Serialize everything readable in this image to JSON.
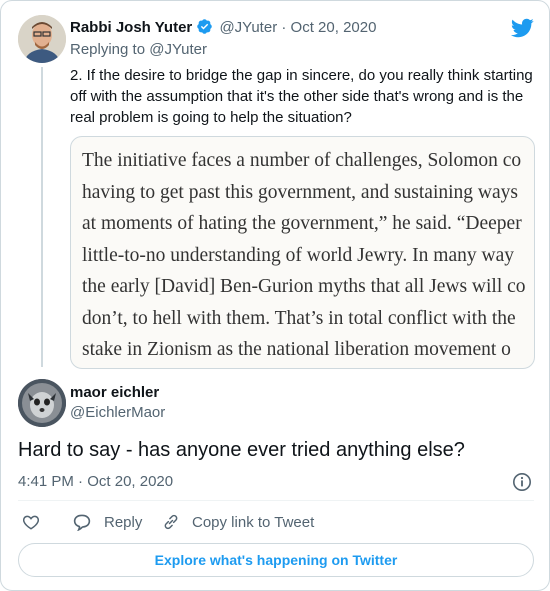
{
  "colors": {
    "accent": "#1d9bf0",
    "muted": "#536471",
    "text": "#0f1419",
    "border": "#cfd9de"
  },
  "parent_tweet": {
    "author_name": "Rabbi Josh Yuter",
    "handle": "@JYuter",
    "separator": "·",
    "date": "Oct 20, 2020",
    "replying_to_prefix": "Replying to",
    "replying_to_handle": "@JYuter",
    "text": "2. If the desire to bridge the gap in sincere, do you really think starting off with the assumption that it's the other side that's wrong and is the real problem is going to help the situation?",
    "image_lines": [
      "The initiative faces a number of challenges, Solomon co",
      "having to get past this government, and sustaining ways",
      "at moments of hating the government,” he said. “Deeper",
      "little-to-no understanding of world Jewry. In many way",
      "the early [David] Ben-Gurion myths that all Jews will co",
      "don’t, to hell with them. That’s in total conflict with the",
      "stake in Zionism as the national liberation movement o"
    ],
    "icons": [
      "verified-badge-icon",
      "twitter-bird-icon"
    ]
  },
  "main_tweet": {
    "author_name": "maor eichler",
    "handle": "@EichlerMaor",
    "text": "Hard to say - has anyone ever tried anything else?",
    "time": "4:41 PM",
    "separator": "·",
    "date": "Oct 20, 2020"
  },
  "actions": {
    "like_label": "",
    "reply_label": "Reply",
    "copy_link_label": "Copy link to Tweet",
    "icons": [
      "heart-icon",
      "reply-icon",
      "link-icon",
      "info-icon"
    ]
  },
  "footer": {
    "explore_label": "Explore what's happening on Twitter"
  }
}
